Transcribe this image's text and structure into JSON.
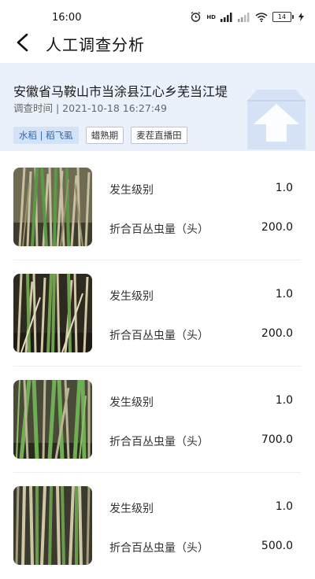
{
  "status_bar": {
    "time": "16:00",
    "network_label": "HD",
    "battery_level": "14"
  },
  "nav": {
    "title": "人工调查分析"
  },
  "header": {
    "location": "安徽省马鞍山市当涂县江心乡芜当江堤",
    "survey_time": "调查时间 | 2021-10-18 16:27:49",
    "tags": [
      "水稻 | 稻飞虱",
      "蜡熟期",
      "麦茬直播田"
    ]
  },
  "records": [
    {
      "level_label": "发生级别",
      "level_value": "1.0",
      "count_label": "折合百丛虫量（头）",
      "count_value": "200.0"
    },
    {
      "level_label": "发生级别",
      "level_value": "1.0",
      "count_label": "折合百丛虫量（头）",
      "count_value": "200.0"
    },
    {
      "level_label": "发生级别",
      "level_value": "1.0",
      "count_label": "折合百丛虫量（头）",
      "count_value": "700.0"
    },
    {
      "level_label": "发生级别",
      "level_value": "1.0",
      "count_label": "折合百丛虫量（头）",
      "count_value": "500.0"
    }
  ],
  "colors": {
    "header_bg": "#eaf1fb",
    "tag_primary_bg": "#d4e2f7",
    "tag_primary_text": "#2c64b8"
  }
}
